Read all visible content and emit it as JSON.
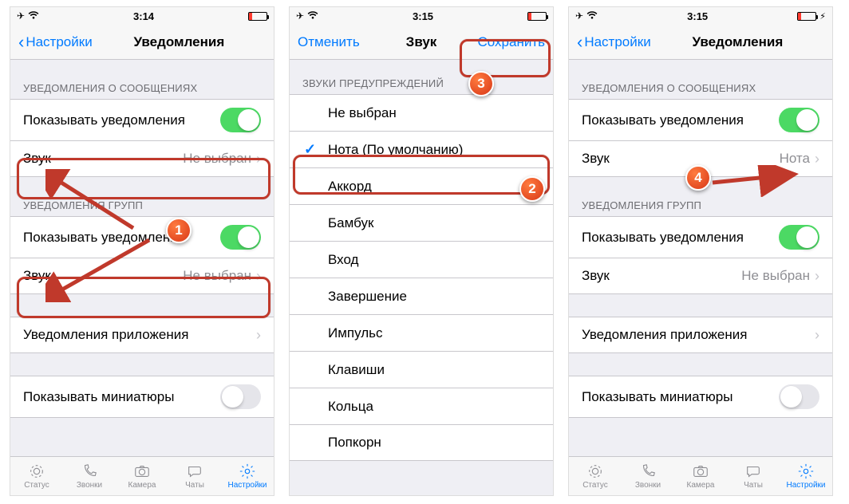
{
  "status": {
    "timeA": "3:14",
    "timeB": "3:15",
    "timeC": "3:15"
  },
  "nav": {
    "back": "Настройки",
    "title": "Уведомления",
    "cancel": "Отменить",
    "soundTitle": "Звук",
    "save": "Сохранить"
  },
  "sections": {
    "msg": "УВЕДОМЛЕНИЯ О СООБЩЕНИЯХ",
    "group": "УВЕДОМЛЕНИЯ ГРУПП",
    "sounds": "ЗВУКИ ПРЕДУПРЕЖДЕНИЙ"
  },
  "rows": {
    "showNotif": "Показывать уведомления",
    "sound": "Звук",
    "noneSelected": "Не выбран",
    "nota": "Нота",
    "appNotif": "Уведомления приложения",
    "showThumbs": "Показывать миниатюры"
  },
  "sounds": [
    "Не выбран",
    "Нота (По умолчанию)",
    "Аккорд",
    "Бамбук",
    "Вход",
    "Завершение",
    "Импульс",
    "Клавиши",
    "Кольца",
    "Попкорн"
  ],
  "tabs": {
    "status": "Статус",
    "calls": "Звонки",
    "camera": "Камера",
    "chats": "Чаты",
    "settings": "Настройки"
  },
  "badges": {
    "b1": "1",
    "b2": "2",
    "b3": "3",
    "b4": "4"
  }
}
